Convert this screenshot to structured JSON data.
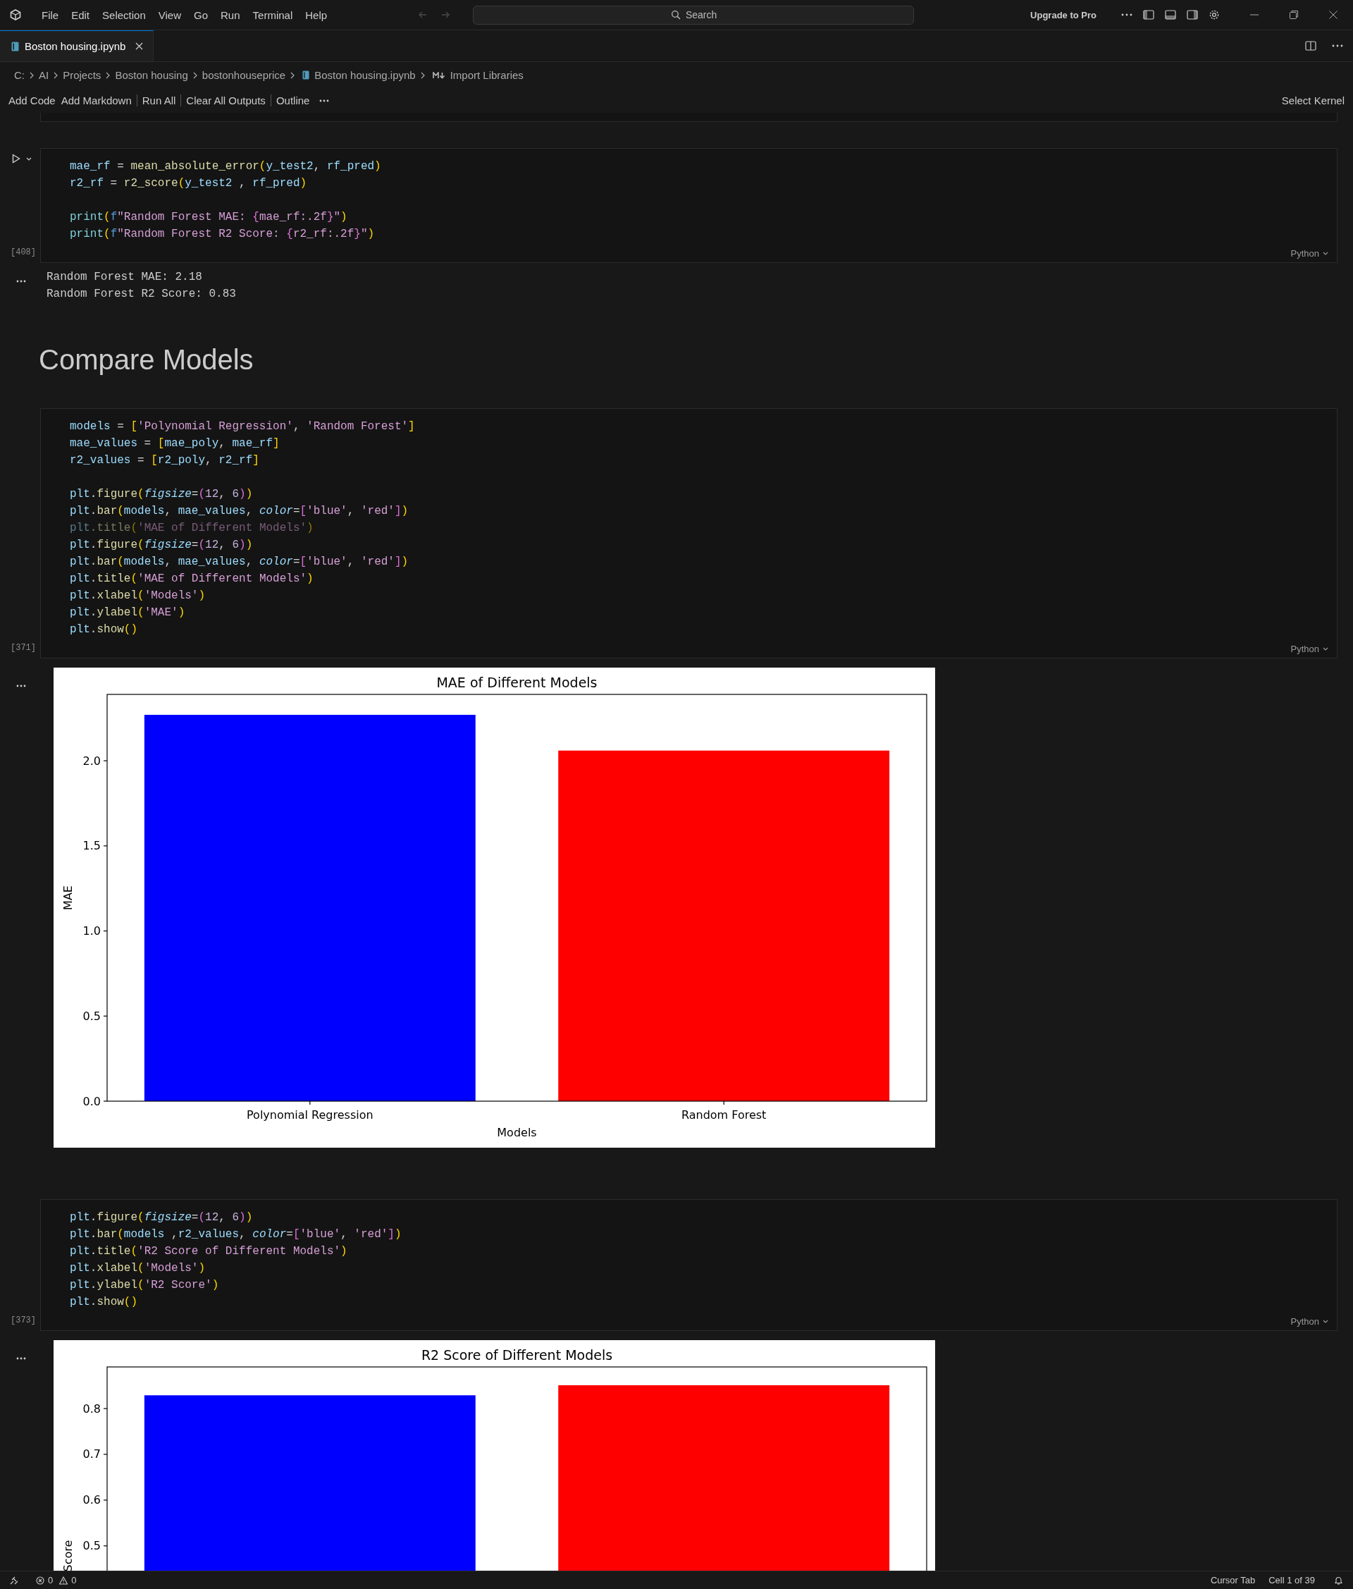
{
  "menu": [
    "File",
    "Edit",
    "Selection",
    "View",
    "Go",
    "Run",
    "Terminal",
    "Help"
  ],
  "search": {
    "placeholder": "Search"
  },
  "upgrade": "Upgrade to Pro",
  "tabs": [
    {
      "label": "Boston housing.ipynb",
      "selected": true
    }
  ],
  "breadcrumb": [
    {
      "label": "C:",
      "kind": "folder"
    },
    {
      "label": "AI",
      "kind": "folder"
    },
    {
      "label": "Projects",
      "kind": "folder"
    },
    {
      "label": "Boston housing",
      "kind": "folder"
    },
    {
      "label": "bostonhouseprice",
      "kind": "folder"
    },
    {
      "label": "Boston housing.ipynb",
      "kind": "notebook"
    },
    {
      "label": "Import Libraries",
      "kind": "markdown"
    }
  ],
  "toolbar": {
    "actions": [
      "Add Code",
      "Add Markdown",
      "Run All",
      "Clear All Outputs",
      "Outline"
    ],
    "kernel": "Select Kernel"
  },
  "cells": [
    {
      "kind": "code",
      "count": "[408]",
      "language": "Python",
      "lines": [
        {
          "kind": "code",
          "faded": false,
          "tokens": [
            {
              "kind": "v",
              "text": "mae_rf"
            },
            {
              "kind": "p",
              "text": " = "
            },
            {
              "kind": "f",
              "text": "mean_absolute_error"
            },
            {
              "kind": "b1",
              "text": "("
            },
            {
              "kind": "v",
              "text": "y_test2"
            },
            {
              "kind": "p",
              "text": ", "
            },
            {
              "kind": "v",
              "text": "rf_pred"
            },
            {
              "kind": "b1",
              "text": ")"
            }
          ]
        },
        {
          "kind": "code",
          "faded": false,
          "tokens": [
            {
              "kind": "v",
              "text": "r2_rf"
            },
            {
              "kind": "p",
              "text": " = "
            },
            {
              "kind": "f",
              "text": "r2_score"
            },
            {
              "kind": "b1",
              "text": "("
            },
            {
              "kind": "v",
              "text": "y_test2"
            },
            {
              "kind": "p",
              "text": " , "
            },
            {
              "kind": "v",
              "text": "rf_pred"
            },
            {
              "kind": "b1",
              "text": ")"
            }
          ]
        },
        {
          "kind": "blank"
        },
        {
          "kind": "code",
          "faded": false,
          "tokens": [
            {
              "kind": "bi",
              "text": "print"
            },
            {
              "kind": "b1",
              "text": "("
            },
            {
              "kind": "k",
              "text": "f"
            },
            {
              "kind": "s",
              "text": "\"Random Forest MAE: "
            },
            {
              "kind": "b2",
              "text": "{"
            },
            {
              "kind": "s",
              "text": "mae_rf:.2f"
            },
            {
              "kind": "b2",
              "text": "}"
            },
            {
              "kind": "s",
              "text": "\""
            },
            {
              "kind": "b1",
              "text": ")"
            }
          ]
        },
        {
          "kind": "code",
          "faded": false,
          "tokens": [
            {
              "kind": "bi",
              "text": "print"
            },
            {
              "kind": "b1",
              "text": "("
            },
            {
              "kind": "k",
              "text": "f"
            },
            {
              "kind": "s",
              "text": "\"Random Forest R2 Score: "
            },
            {
              "kind": "b2",
              "text": "{"
            },
            {
              "kind": "s",
              "text": "r2_rf:.2f"
            },
            {
              "kind": "b2",
              "text": "}"
            },
            {
              "kind": "s",
              "text": "\""
            },
            {
              "kind": "b1",
              "text": ")"
            }
          ]
        }
      ],
      "output": {
        "kind": "text",
        "lines": [
          "Random Forest MAE: 2.18",
          "Random Forest R2 Score: 0.83"
        ]
      }
    },
    {
      "kind": "markdown",
      "heading": "Compare Models"
    },
    {
      "kind": "code",
      "count": "[371]",
      "language": "Python",
      "lines": [
        {
          "kind": "code",
          "faded": false,
          "tokens": [
            {
              "kind": "v",
              "text": "models"
            },
            {
              "kind": "p",
              "text": " = "
            },
            {
              "kind": "b1",
              "text": "["
            },
            {
              "kind": "s",
              "text": "'Polynomial Regression'"
            },
            {
              "kind": "p",
              "text": ", "
            },
            {
              "kind": "s",
              "text": "'Random Forest'"
            },
            {
              "kind": "b1",
              "text": "]"
            }
          ]
        },
        {
          "kind": "code",
          "faded": false,
          "tokens": [
            {
              "kind": "v",
              "text": "mae_values"
            },
            {
              "kind": "p",
              "text": " = "
            },
            {
              "kind": "b1",
              "text": "["
            },
            {
              "kind": "v",
              "text": "mae_poly"
            },
            {
              "kind": "p",
              "text": ", "
            },
            {
              "kind": "v",
              "text": "mae_rf"
            },
            {
              "kind": "b1",
              "text": "]"
            }
          ]
        },
        {
          "kind": "code",
          "faded": false,
          "tokens": [
            {
              "kind": "v",
              "text": "r2_values"
            },
            {
              "kind": "p",
              "text": " = "
            },
            {
              "kind": "b1",
              "text": "["
            },
            {
              "kind": "v",
              "text": "r2_poly"
            },
            {
              "kind": "p",
              "text": ", "
            },
            {
              "kind": "v",
              "text": "r2_rf"
            },
            {
              "kind": "b1",
              "text": "]"
            }
          ]
        },
        {
          "kind": "blank"
        },
        {
          "kind": "code",
          "faded": false,
          "tokens": [
            {
              "kind": "v",
              "text": "plt"
            },
            {
              "kind": "p",
              "text": "."
            },
            {
              "kind": "f",
              "text": "figure"
            },
            {
              "kind": "b1",
              "text": "("
            },
            {
              "kind": "prm",
              "text": "figsize"
            },
            {
              "kind": "p",
              "text": "="
            },
            {
              "kind": "b2",
              "text": "("
            },
            {
              "kind": "n",
              "text": "12"
            },
            {
              "kind": "p",
              "text": ", "
            },
            {
              "kind": "n",
              "text": "6"
            },
            {
              "kind": "b2",
              "text": ")"
            },
            {
              "kind": "b1",
              "text": ")"
            }
          ]
        },
        {
          "kind": "code",
          "faded": false,
          "tokens": [
            {
              "kind": "v",
              "text": "plt"
            },
            {
              "kind": "p",
              "text": "."
            },
            {
              "kind": "f",
              "text": "bar"
            },
            {
              "kind": "b1",
              "text": "("
            },
            {
              "kind": "v",
              "text": "models"
            },
            {
              "kind": "p",
              "text": ", "
            },
            {
              "kind": "v",
              "text": "mae_values"
            },
            {
              "kind": "p",
              "text": ", "
            },
            {
              "kind": "prm",
              "text": "color"
            },
            {
              "kind": "p",
              "text": "="
            },
            {
              "kind": "b2",
              "text": "["
            },
            {
              "kind": "s",
              "text": "'blue'"
            },
            {
              "kind": "p",
              "text": ", "
            },
            {
              "kind": "s",
              "text": "'red'"
            },
            {
              "kind": "b2",
              "text": "]"
            },
            {
              "kind": "b1",
              "text": ")"
            }
          ]
        },
        {
          "kind": "code",
          "faded": true,
          "tokens": [
            {
              "kind": "v",
              "text": "plt"
            },
            {
              "kind": "p",
              "text": "."
            },
            {
              "kind": "f",
              "text": "title"
            },
            {
              "kind": "b1",
              "text": "("
            },
            {
              "kind": "s",
              "text": "'MAE of Different Models'"
            },
            {
              "kind": "b1",
              "text": ")"
            }
          ]
        },
        {
          "kind": "code",
          "faded": false,
          "tokens": [
            {
              "kind": "v",
              "text": "plt"
            },
            {
              "kind": "p",
              "text": "."
            },
            {
              "kind": "f",
              "text": "figure"
            },
            {
              "kind": "b1",
              "text": "("
            },
            {
              "kind": "prm",
              "text": "figsize"
            },
            {
              "kind": "p",
              "text": "="
            },
            {
              "kind": "b2",
              "text": "("
            },
            {
              "kind": "n",
              "text": "12"
            },
            {
              "kind": "p",
              "text": ", "
            },
            {
              "kind": "n",
              "text": "6"
            },
            {
              "kind": "b2",
              "text": ")"
            },
            {
              "kind": "b1",
              "text": ")"
            }
          ]
        },
        {
          "kind": "code",
          "faded": false,
          "tokens": [
            {
              "kind": "v",
              "text": "plt"
            },
            {
              "kind": "p",
              "text": "."
            },
            {
              "kind": "f",
              "text": "bar"
            },
            {
              "kind": "b1",
              "text": "("
            },
            {
              "kind": "v",
              "text": "models"
            },
            {
              "kind": "p",
              "text": ", "
            },
            {
              "kind": "v",
              "text": "mae_values"
            },
            {
              "kind": "p",
              "text": ", "
            },
            {
              "kind": "prm",
              "text": "color"
            },
            {
              "kind": "p",
              "text": "="
            },
            {
              "kind": "b2",
              "text": "["
            },
            {
              "kind": "s",
              "text": "'blue'"
            },
            {
              "kind": "p",
              "text": ", "
            },
            {
              "kind": "s",
              "text": "'red'"
            },
            {
              "kind": "b2",
              "text": "]"
            },
            {
              "kind": "b1",
              "text": ")"
            }
          ]
        },
        {
          "kind": "code",
          "faded": false,
          "tokens": [
            {
              "kind": "v",
              "text": "plt"
            },
            {
              "kind": "p",
              "text": "."
            },
            {
              "kind": "f",
              "text": "title"
            },
            {
              "kind": "b1",
              "text": "("
            },
            {
              "kind": "s",
              "text": "'MAE of Different Models'"
            },
            {
              "kind": "b1",
              "text": ")"
            }
          ]
        },
        {
          "kind": "code",
          "faded": false,
          "tokens": [
            {
              "kind": "v",
              "text": "plt"
            },
            {
              "kind": "p",
              "text": "."
            },
            {
              "kind": "f",
              "text": "xlabel"
            },
            {
              "kind": "b1",
              "text": "("
            },
            {
              "kind": "s",
              "text": "'Models'"
            },
            {
              "kind": "b1",
              "text": ")"
            }
          ]
        },
        {
          "kind": "code",
          "faded": false,
          "tokens": [
            {
              "kind": "v",
              "text": "plt"
            },
            {
              "kind": "p",
              "text": "."
            },
            {
              "kind": "f",
              "text": "ylabel"
            },
            {
              "kind": "b1",
              "text": "("
            },
            {
              "kind": "s",
              "text": "'MAE'"
            },
            {
              "kind": "b1",
              "text": ")"
            }
          ]
        },
        {
          "kind": "code",
          "faded": false,
          "tokens": [
            {
              "kind": "v",
              "text": "plt"
            },
            {
              "kind": "p",
              "text": "."
            },
            {
              "kind": "f",
              "text": "show"
            },
            {
              "kind": "b1",
              "text": "()"
            }
          ]
        }
      ],
      "output": {
        "kind": "chart",
        "chart_data": {
          "type": "bar",
          "title": "MAE of Different Models",
          "xlabel": "Models",
          "ylabel": "MAE",
          "categories": [
            "Polynomial Regression",
            "Random Forest"
          ],
          "series": [
            {
              "color": "#0000ff",
              "values": [
                2.27,
                null
              ]
            },
            {
              "color": "#ff0000",
              "values": [
                null,
                2.06
              ]
            }
          ],
          "ylim": [
            0,
            2.39
          ],
          "yticks": [
            {
              "value": 0,
              "label": "0.0"
            },
            {
              "value": 0.5,
              "label": "0.5"
            },
            {
              "value": 1,
              "label": "1.0"
            },
            {
              "value": 1.5,
              "label": "1.5"
            },
            {
              "value": 2,
              "label": "2.0"
            }
          ]
        }
      }
    },
    {
      "kind": "code",
      "count": "[373]",
      "language": "Python",
      "lines": [
        {
          "kind": "code",
          "faded": false,
          "tokens": [
            {
              "kind": "v",
              "text": "plt"
            },
            {
              "kind": "p",
              "text": "."
            },
            {
              "kind": "f",
              "text": "figure"
            },
            {
              "kind": "b1",
              "text": "("
            },
            {
              "kind": "prm",
              "text": "figsize"
            },
            {
              "kind": "p",
              "text": "="
            },
            {
              "kind": "b2",
              "text": "("
            },
            {
              "kind": "n",
              "text": "12"
            },
            {
              "kind": "p",
              "text": ", "
            },
            {
              "kind": "n",
              "text": "6"
            },
            {
              "kind": "b2",
              "text": ")"
            },
            {
              "kind": "b1",
              "text": ")"
            }
          ]
        },
        {
          "kind": "code",
          "faded": false,
          "tokens": [
            {
              "kind": "v",
              "text": "plt"
            },
            {
              "kind": "p",
              "text": "."
            },
            {
              "kind": "f",
              "text": "bar"
            },
            {
              "kind": "b1",
              "text": "("
            },
            {
              "kind": "v",
              "text": "models"
            },
            {
              "kind": "p",
              "text": " ,"
            },
            {
              "kind": "v",
              "text": "r2_values"
            },
            {
              "kind": "p",
              "text": ", "
            },
            {
              "kind": "prm",
              "text": "color"
            },
            {
              "kind": "p",
              "text": "="
            },
            {
              "kind": "b2",
              "text": "["
            },
            {
              "kind": "s",
              "text": "'blue'"
            },
            {
              "kind": "p",
              "text": ", "
            },
            {
              "kind": "s",
              "text": "'red'"
            },
            {
              "kind": "b2",
              "text": "]"
            },
            {
              "kind": "b1",
              "text": ")"
            }
          ]
        },
        {
          "kind": "code",
          "faded": false,
          "tokens": [
            {
              "kind": "v",
              "text": "plt"
            },
            {
              "kind": "p",
              "text": "."
            },
            {
              "kind": "f",
              "text": "title"
            },
            {
              "kind": "b1",
              "text": "("
            },
            {
              "kind": "s",
              "text": "'R2 Score of Different Models'"
            },
            {
              "kind": "b1",
              "text": ")"
            }
          ]
        },
        {
          "kind": "code",
          "faded": false,
          "tokens": [
            {
              "kind": "v",
              "text": "plt"
            },
            {
              "kind": "p",
              "text": "."
            },
            {
              "kind": "f",
              "text": "xlabel"
            },
            {
              "kind": "b1",
              "text": "("
            },
            {
              "kind": "s",
              "text": "'Models'"
            },
            {
              "kind": "b1",
              "text": ")"
            }
          ]
        },
        {
          "kind": "code",
          "faded": false,
          "tokens": [
            {
              "kind": "v",
              "text": "plt"
            },
            {
              "kind": "p",
              "text": "."
            },
            {
              "kind": "f",
              "text": "ylabel"
            },
            {
              "kind": "b1",
              "text": "("
            },
            {
              "kind": "s",
              "text": "'R2 Score'"
            },
            {
              "kind": "b1",
              "text": ")"
            }
          ]
        },
        {
          "kind": "code",
          "faded": false,
          "tokens": [
            {
              "kind": "v",
              "text": "plt"
            },
            {
              "kind": "p",
              "text": "."
            },
            {
              "kind": "f",
              "text": "show"
            },
            {
              "kind": "b1",
              "text": "()"
            }
          ]
        }
      ],
      "output": {
        "kind": "chart",
        "chart_data": {
          "type": "bar",
          "title": "R2 Score of Different Models",
          "ylabel": "Score",
          "series": [
            {
              "color": "#0000ff",
              "values": [
                0.829,
                null
              ]
            },
            {
              "color": "#ff0000",
              "values": [
                null,
                0.851
              ]
            }
          ],
          "ylim": [
            0.435,
            0.891
          ],
          "yticks": [
            0.5,
            0.6,
            0.7,
            0.8
          ]
        }
      }
    }
  ],
  "status_bar": {
    "errors": "0",
    "warnings": "0",
    "items": [
      "Cursor Tab",
      "Cell 1 of 39"
    ]
  }
}
